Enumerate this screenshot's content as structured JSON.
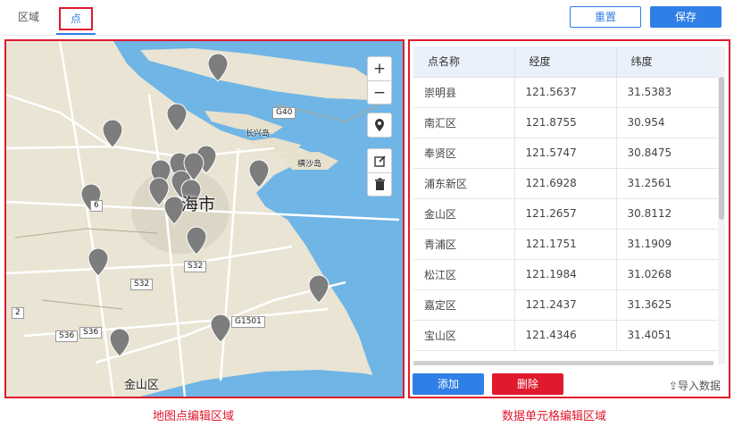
{
  "tabs": [
    {
      "label": "区域"
    },
    {
      "label": "点"
    }
  ],
  "actions": {
    "reset_label": "重置",
    "save_label": "保存"
  },
  "map": {
    "city_label": "海市",
    "district_label": "金山区",
    "island_label_1": "长兴岛",
    "island_label_2": "横沙岛",
    "road_labels": [
      "G40",
      "S32",
      "S32",
      "G1501",
      "S36",
      "S36",
      "6",
      "2"
    ],
    "controls": {
      "zoom_in": "+",
      "zoom_out": "−"
    },
    "colors": {
      "water": "#6fb5e6",
      "land": "#e9e4d3",
      "marker": "#7d7d7d"
    }
  },
  "table": {
    "columns": [
      "点名称",
      "经度",
      "纬度"
    ],
    "rows": [
      [
        "崇明县",
        "121.5637",
        "31.5383"
      ],
      [
        "南汇区",
        "121.8755",
        "30.954"
      ],
      [
        "奉贤区",
        "121.5747",
        "30.8475"
      ],
      [
        "浦东新区",
        "121.6928",
        "31.2561"
      ],
      [
        "金山区",
        "121.2657",
        "30.8112"
      ],
      [
        "青浦区",
        "121.1751",
        "31.1909"
      ],
      [
        "松江区",
        "121.1984",
        "31.0268"
      ],
      [
        "嘉定区",
        "121.2437",
        "31.3625"
      ],
      [
        "宝山区",
        "121.4346",
        "31.4051"
      ]
    ],
    "add_label": "添加",
    "delete_label": "删除",
    "import_label": "⇪导入数据"
  },
  "captions": {
    "map": "地图点编辑区域",
    "table": "数据单元格编辑区域"
  },
  "colors": {
    "primary": "#2f7fe6",
    "danger": "#e0192d"
  }
}
